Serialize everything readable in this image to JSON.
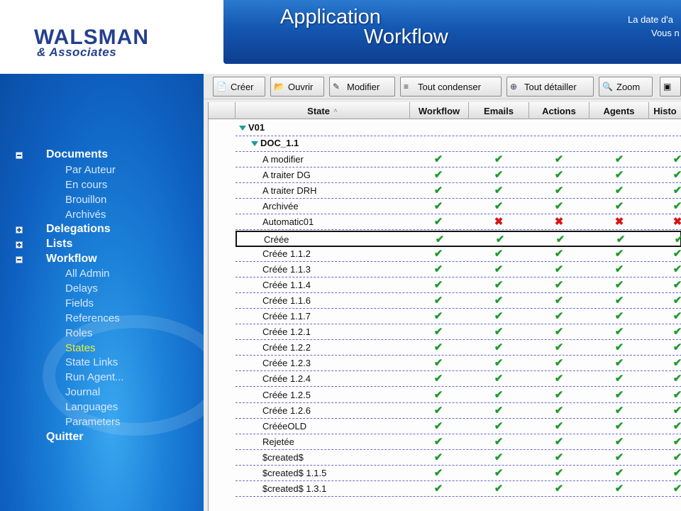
{
  "header": {
    "logo_main": "WALSMAN",
    "logo_sub": "& Associates",
    "title_line1": "Application",
    "title_line2": "Workflow",
    "date_text": "La date d'a",
    "user_text": "Vous n"
  },
  "sidebar": {
    "sections": [
      {
        "label": "Documents",
        "expander": "minus",
        "children": [
          "Par Auteur",
          "En cours",
          "Brouillon",
          "Archivés"
        ]
      },
      {
        "label": "Delegations",
        "expander": "plus",
        "children": []
      },
      {
        "label": "Lists",
        "expander": "plus",
        "children": []
      },
      {
        "label": "Workflow",
        "expander": "minus",
        "children": [
          "All Admin",
          "Delays",
          "Fields",
          "References",
          "Roles",
          "States",
          "State Links",
          "Run Agent...",
          "Journal",
          "Languages",
          "Parameters"
        ]
      },
      {
        "label": "Quitter",
        "expander": "none",
        "children": []
      }
    ],
    "active_item": "States",
    "active_color": "#e8ee3a"
  },
  "toolbar": {
    "buttons": [
      {
        "label": "Créer",
        "icon": "new-doc-icon"
      },
      {
        "label": "Ouvrir",
        "icon": "open-icon"
      },
      {
        "label": "Modifier",
        "icon": "edit-pencil-icon"
      },
      {
        "label": "Tout condenser",
        "icon": "collapse-icon"
      },
      {
        "label": "Tout détailler",
        "icon": "expand-icon"
      },
      {
        "label": "Zoom",
        "icon": "zoom-icon"
      }
    ]
  },
  "grid": {
    "columns": [
      "State",
      "Workflow",
      "Emails",
      "Actions",
      "Agents",
      "Histo"
    ],
    "sorted_column": "State",
    "groups": {
      "level1": "V01",
      "level2": "DOC_1.1"
    },
    "rows": [
      {
        "state": "A modifier",
        "marks": [
          "ok",
          "ok",
          "ok",
          "ok",
          "ok"
        ]
      },
      {
        "state": "A traiter DG",
        "marks": [
          "ok",
          "ok",
          "ok",
          "ok",
          "ok"
        ]
      },
      {
        "state": "A traiter DRH",
        "marks": [
          "ok",
          "ok",
          "ok",
          "ok",
          "ok"
        ]
      },
      {
        "state": "Archivée",
        "marks": [
          "ok",
          "ok",
          "ok",
          "ok",
          "ok"
        ]
      },
      {
        "state": "Automatic01",
        "marks": [
          "ok",
          "ko",
          "ko",
          "ko",
          "ko"
        ]
      },
      {
        "state": "Créée",
        "marks": [
          "ok",
          "ok",
          "ok",
          "ok",
          "ok"
        ],
        "selected": true
      },
      {
        "state": "Créée 1.1.2",
        "marks": [
          "ok",
          "ok",
          "ok",
          "ok",
          "ok"
        ]
      },
      {
        "state": "Créée 1.1.3",
        "marks": [
          "ok",
          "ok",
          "ok",
          "ok",
          "ok"
        ]
      },
      {
        "state": "Créée 1.1.4",
        "marks": [
          "ok",
          "ok",
          "ok",
          "ok",
          "ok"
        ]
      },
      {
        "state": "Créée 1.1.6",
        "marks": [
          "ok",
          "ok",
          "ok",
          "ok",
          "ok"
        ]
      },
      {
        "state": "Créée 1.1.7",
        "marks": [
          "ok",
          "ok",
          "ok",
          "ok",
          "ok"
        ]
      },
      {
        "state": "Créée 1.2.1",
        "marks": [
          "ok",
          "ok",
          "ok",
          "ok",
          "ok"
        ]
      },
      {
        "state": "Créée 1.2.2",
        "marks": [
          "ok",
          "ok",
          "ok",
          "ok",
          "ok"
        ]
      },
      {
        "state": "Créée 1.2.3",
        "marks": [
          "ok",
          "ok",
          "ok",
          "ok",
          "ok"
        ]
      },
      {
        "state": "Créée 1.2.4",
        "marks": [
          "ok",
          "ok",
          "ok",
          "ok",
          "ok"
        ]
      },
      {
        "state": "Créée 1.2.5",
        "marks": [
          "ok",
          "ok",
          "ok",
          "ok",
          "ok"
        ]
      },
      {
        "state": "Créée 1.2.6",
        "marks": [
          "ok",
          "ok",
          "ok",
          "ok",
          "ok"
        ]
      },
      {
        "state": "CrééeOLD",
        "marks": [
          "ok",
          "ok",
          "ok",
          "ok",
          "ok"
        ]
      },
      {
        "state": "Rejetée",
        "marks": [
          "ok",
          "ok",
          "ok",
          "ok",
          "ok"
        ]
      },
      {
        "state": "$created$",
        "marks": [
          "ok",
          "ok",
          "ok",
          "ok",
          "ok"
        ]
      },
      {
        "state": "$created$ 1.1.5",
        "marks": [
          "ok",
          "ok",
          "ok",
          "ok",
          "ok"
        ]
      },
      {
        "state": "$created$ 1.3.1",
        "marks": [
          "ok",
          "ok",
          "ok",
          "ok",
          "ok"
        ]
      }
    ],
    "ok_symbol": "✔",
    "ko_symbol": "✖",
    "ok_color": "#1e9a2e",
    "ko_color": "#d41616"
  }
}
